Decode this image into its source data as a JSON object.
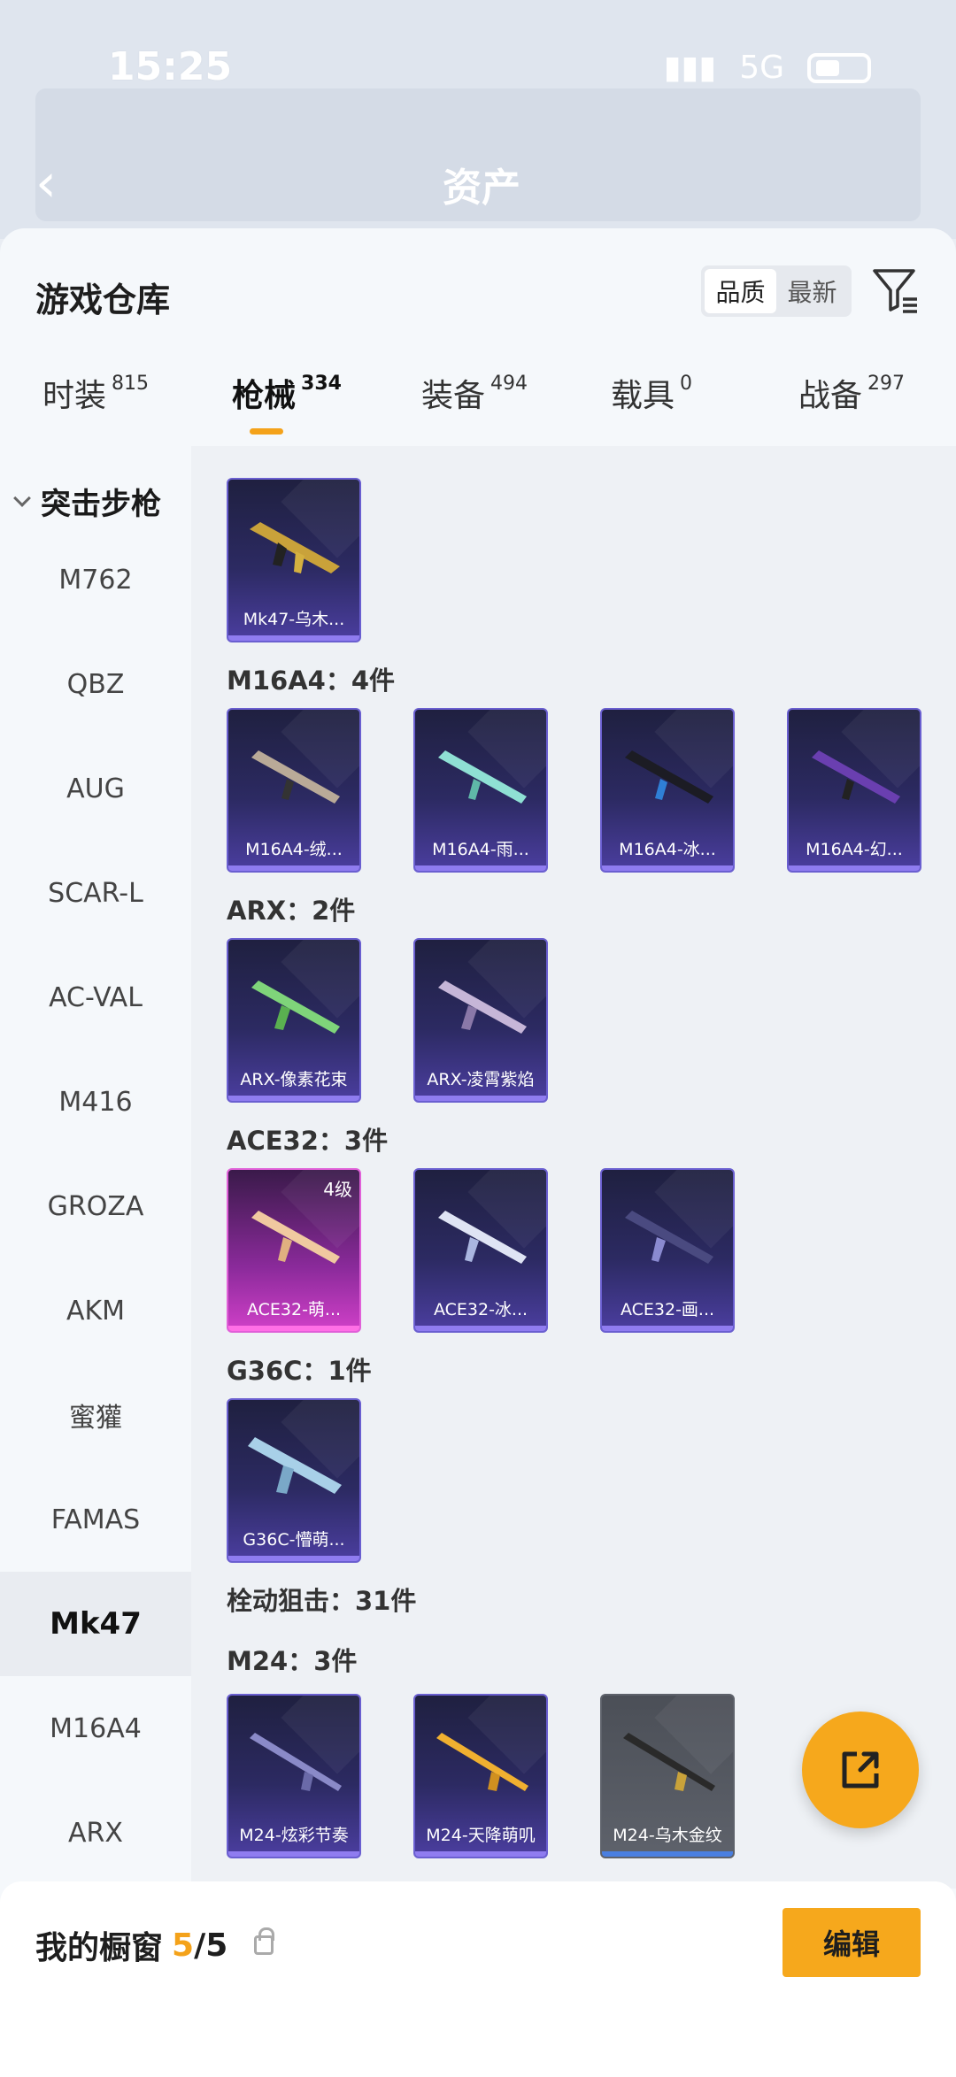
{
  "status": {
    "time": "15:25",
    "network": "5G"
  },
  "header": {
    "title": "资产"
  },
  "sheet": {
    "title": "游戏仓库",
    "sort": [
      {
        "label": "品质",
        "active": true
      },
      {
        "label": "最新",
        "active": false
      }
    ]
  },
  "tabs": [
    {
      "label": "时装",
      "count": "815"
    },
    {
      "label": "枪械",
      "count": "334",
      "active": true
    },
    {
      "label": "装备",
      "count": "494"
    },
    {
      "label": "载具",
      "count": "0"
    },
    {
      "label": "战备",
      "count": "297"
    }
  ],
  "categories": {
    "header": "突击步枪",
    "items": [
      "M762",
      "QBZ",
      "AUG",
      "SCAR-L",
      "AC-VAL",
      "M416",
      "GROZA",
      "AKM",
      "蜜獾",
      "FAMAS",
      "Mk47",
      "M16A4",
      "ARX"
    ],
    "active": "Mk47"
  },
  "groups": {
    "mk47": {
      "cards": [
        "Mk47-乌木..."
      ]
    },
    "m16a4": {
      "label": "M16A4：4件",
      "cards": [
        "M16A4-绒...",
        "M16A4-雨...",
        "M16A4-冰...",
        "M16A4-幻..."
      ]
    },
    "arx": {
      "label": "ARX：2件",
      "cards": [
        "ARX-像素花束",
        "ARX-凌霄紫焰"
      ]
    },
    "ace32": {
      "label": "ACE32：3件",
      "cards": [
        "ACE32-萌...",
        "ACE32-冰...",
        "ACE32-画..."
      ],
      "level": "4级"
    },
    "g36c": {
      "label": "G36C：1件",
      "cards": [
        "G36C-懵萌..."
      ]
    },
    "sniper": {
      "label": "栓动狙击：31件"
    },
    "m24": {
      "label": "M24：3件",
      "cards": [
        "M24-炫彩节奏",
        "M24-天降萌叽",
        "M24-乌木金纹"
      ]
    }
  },
  "bottom": {
    "title": "我的橱窗",
    "count": "5",
    "total": "/5",
    "edit_label": "编辑"
  },
  "colors": {
    "accent": "#f6a81c",
    "card_purple": "#2c2a62",
    "card_pink": "#d040c8"
  }
}
